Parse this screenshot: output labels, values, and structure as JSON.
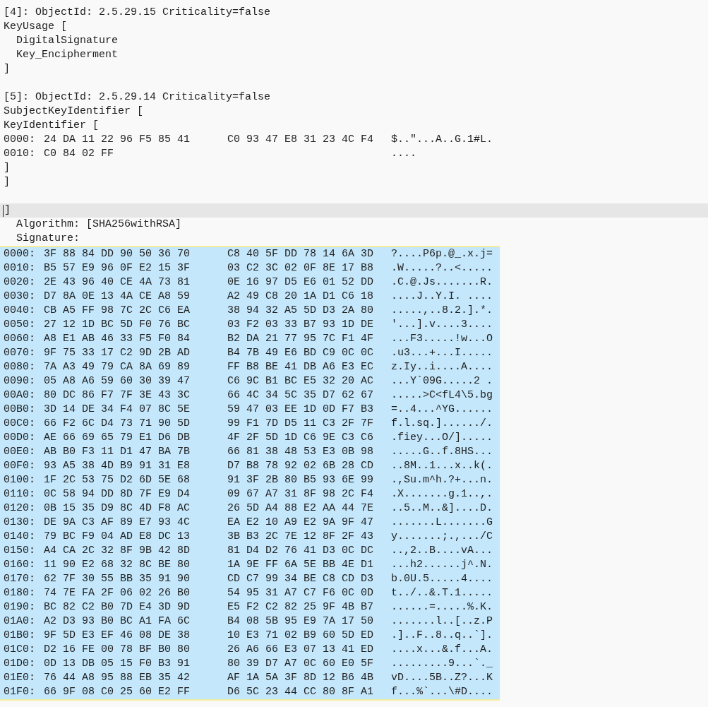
{
  "sections": [
    {
      "blocks": [
        {
          "kind": "text",
          "current": false,
          "lines": [
            "[4]: ObjectId: 2.5.29.15 Criticality=false",
            "KeyUsage [",
            "  DigitalSignature",
            "  Key_Encipherment",
            "]"
          ]
        }
      ]
    },
    {
      "blocks": [
        {
          "kind": "text",
          "current": false,
          "lines": [
            "[5]: ObjectId: 2.5.29.14 Criticality=false",
            "SubjectKeyIdentifier [",
            "KeyIdentifier ["
          ]
        },
        {
          "kind": "dump",
          "selected": false,
          "rows": [
            {
              "offset": "0000:",
              "hex_1": "24 DA 11 22 96 F5 85 41",
              "hex_2": "C0 93 47 E8 31 23 4C F4",
              "ascii": "$..\"...A..G.1#L."
            },
            {
              "offset": "0010:",
              "hex_1": "C0 84 02 FF",
              "ascii": "...."
            }
          ]
        },
        {
          "kind": "text",
          "current": false,
          "lines": [
            "]",
            "]"
          ]
        }
      ]
    },
    {
      "blocks": [
        {
          "kind": "text",
          "current": true,
          "lines": [
            "]"
          ]
        },
        {
          "kind": "text",
          "current": false,
          "lines": [
            "  Algorithm: [SHA256withRSA]",
            "  Signature:"
          ]
        },
        {
          "kind": "dump",
          "selected": true,
          "rows": [
            {
              "offset": "0000:",
              "hex_1": "3F 88 84 DD 90 50 36 70",
              "hex_2": "C8 40 5F DD 78 14 6A 3D",
              "ascii": "?....P6p.@_.x.j="
            },
            {
              "offset": "0010:",
              "hex_1": "B5 57 E9 96 0F E2 15 3F",
              "hex_2": "03 C2 3C 02 0F 8E 17 B8",
              "ascii": ".W.....?..<....."
            },
            {
              "offset": "0020:",
              "hex_1": "2E 43 96 40 CE 4A 73 81",
              "hex_2": "0E 16 97 D5 E6 01 52 DD",
              "ascii": ".C.@.Js.......R."
            },
            {
              "offset": "0030:",
              "hex_1": "D7 8A 0E 13 4A CE A8 59",
              "hex_2": "A2 49 C8 20 1A D1 C6 18",
              "ascii": "....J..Y.I. ...."
            },
            {
              "offset": "0040:",
              "hex_1": "CB A5 FF 98 7C 2C C6 EA",
              "hex_2": "38 94 32 A5 5D D3 2A 80",
              "ascii": ".....,..8.2.].*."
            },
            {
              "offset": "0050:",
              "hex_1": "27 12 1D BC 5D F0 76 BC",
              "hex_2": "03 F2 03 33 B7 93 1D DE",
              "ascii": "'...].v....3...."
            },
            {
              "offset": "0060:",
              "hex_1": "A8 E1 AB 46 33 F5 F0 84",
              "hex_2": "B2 DA 21 77 95 7C F1 4F",
              "ascii": "...F3.....!w...O"
            },
            {
              "offset": "0070:",
              "hex_1": "9F 75 33 17 C2 9D 2B AD",
              "hex_2": "B4 7B 49 E6 BD C9 0C 0C",
              "ascii": ".u3...+...I....."
            },
            {
              "offset": "0080:",
              "hex_1": "7A A3 49 79 CA 8A 69 89",
              "hex_2": "FF B8 BE 41 DB A6 E3 EC",
              "ascii": "z.Iy..i....A...."
            },
            {
              "offset": "0090:",
              "hex_1": "05 A8 A6 59 60 30 39 47",
              "hex_2": "C6 9C B1 BC E5 32 20 AC",
              "ascii": "...Y`09G.....2 ."
            },
            {
              "offset": "00A0:",
              "hex_1": "80 DC 86 F7 7F 3E 43 3C",
              "hex_2": "66 4C 34 5C 35 D7 62 67",
              "ascii": ".....>C<fL4\\5.bg"
            },
            {
              "offset": "00B0:",
              "hex_1": "3D 14 DE 34 F4 07 8C 5E",
              "hex_2": "59 47 03 EE 1D 0D F7 B3",
              "ascii": "=..4...^YG......"
            },
            {
              "offset": "00C0:",
              "hex_1": "66 F2 6C D4 73 71 90 5D",
              "hex_2": "99 F1 7D D5 11 C3 2F 7F",
              "ascii": "f.l.sq.]....../."
            },
            {
              "offset": "00D0:",
              "hex_1": "AE 66 69 65 79 E1 D6 DB",
              "hex_2": "4F 2F 5D 1D C6 9E C3 C6",
              "ascii": ".fiey...O/]....."
            },
            {
              "offset": "00E0:",
              "hex_1": "AB B0 F3 11 D1 47 BA 7B",
              "hex_2": "66 81 38 48 53 E3 0B 98",
              "ascii": ".....G..f.8HS..."
            },
            {
              "offset": "00F0:",
              "hex_1": "93 A5 38 4D B9 91 31 E8",
              "hex_2": "D7 B8 78 92 02 6B 28 CD",
              "ascii": "..8M..1...x..k(."
            },
            {
              "offset": "0100:",
              "hex_1": "1F 2C 53 75 D2 6D 5E 68",
              "hex_2": "91 3F 2B 80 B5 93 6E 99",
              "ascii": ".,Su.m^h.?+...n."
            },
            {
              "offset": "0110:",
              "hex_1": "0C 58 94 DD 8D 7F E9 D4",
              "hex_2": "09 67 A7 31 8F 98 2C F4",
              "ascii": ".X.......g.1..,."
            },
            {
              "offset": "0120:",
              "hex_1": "0B 15 35 D9 8C 4D F8 AC",
              "hex_2": "26 5D A4 88 E2 AA 44 7E",
              "ascii": "..5..M..&]....D."
            },
            {
              "offset": "0130:",
              "hex_1": "DE 9A C3 AF 89 E7 93 4C",
              "hex_2": "EA E2 10 A9 E2 9A 9F 47",
              "ascii": ".......L.......G"
            },
            {
              "offset": "0140:",
              "hex_1": "79 BC F9 04 AD E8 DC 13",
              "hex_2": "3B B3 2C 7E 12 8F 2F 43",
              "ascii": "y.......;.,.../C"
            },
            {
              "offset": "0150:",
              "hex_1": "A4 CA 2C 32 8F 9B 42 8D",
              "hex_2": "81 D4 D2 76 41 D3 0C DC",
              "ascii": "..,2..B....vA..."
            },
            {
              "offset": "0160:",
              "hex_1": "11 90 E2 68 32 8C BE 80",
              "hex_2": "1A 9E FF 6A 5E BB 4E D1",
              "ascii": "...h2......j^.N."
            },
            {
              "offset": "0170:",
              "hex_1": "62 7F 30 55 BB 35 91 90",
              "hex_2": "CD C7 99 34 BE C8 CD D3",
              "ascii": "b.0U.5.....4...."
            },
            {
              "offset": "0180:",
              "hex_1": "74 7E FA 2F 06 02 26 B0",
              "hex_2": "54 95 31 A7 C7 F6 0C 0D",
              "ascii": "t../..&.T.1....."
            },
            {
              "offset": "0190:",
              "hex_1": "BC 82 C2 B0 7D E4 3D 9D",
              "hex_2": "E5 F2 C2 82 25 9F 4B B7",
              "ascii": "......=.....%.K."
            },
            {
              "offset": "01A0:",
              "hex_1": "A2 D3 93 B0 BC A1 FA 6C",
              "hex_2": "B4 08 5B 95 E9 7A 17 50",
              "ascii": ".......l..[..z.P"
            },
            {
              "offset": "01B0:",
              "hex_1": "9F 5D E3 EF 46 08 DE 38",
              "hex_2": "10 E3 71 02 B9 60 5D ED",
              "ascii": ".]..F..8..q..`]."
            },
            {
              "offset": "01C0:",
              "hex_1": "D2 16 FE 00 78 BF B0 80",
              "hex_2": "26 A6 66 E3 07 13 41 ED",
              "ascii": "....x...&.f...A."
            },
            {
              "offset": "01D0:",
              "hex_1": "0D 13 DB 05 15 F0 B3 91",
              "hex_2": "80 39 D7 A7 0C 60 E0 5F",
              "ascii": ".........9...`._"
            },
            {
              "offset": "01E0:",
              "hex_1": "76 44 A8 95 88 EB 35 42",
              "hex_2": "AF 1A 5A 3F 8D 12 B6 4B",
              "ascii": "vD....5B..Z?...K"
            },
            {
              "offset": "01F0:",
              "hex_1": "66 9F 08 C0 25 60 E2 FF",
              "hex_2": "D6 5C 23 44 CC 80 8F A1",
              "ascii": "f...%`...\\#D...."
            }
          ]
        }
      ]
    }
  ]
}
